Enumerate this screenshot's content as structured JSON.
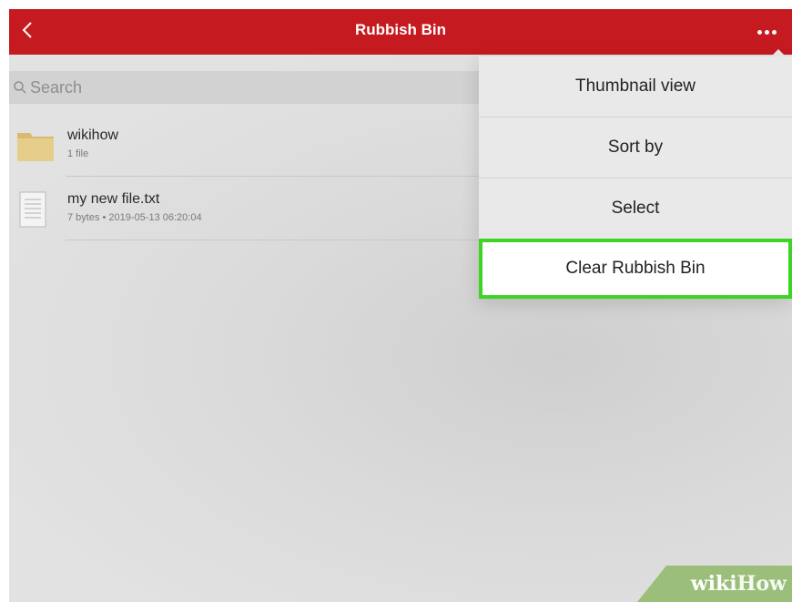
{
  "header": {
    "title": "Rubbish Bin",
    "back_icon": "chevron-left-icon",
    "more_icon": "more-dots-icon"
  },
  "search": {
    "placeholder": "Search",
    "icon": "search-icon"
  },
  "files": [
    {
      "name": "wikihow",
      "meta": "1 file",
      "icon": "folder-icon"
    },
    {
      "name": "my new file.txt",
      "meta": "7 bytes • 2019-05-13 06:20:04",
      "icon": "text-file-icon"
    }
  ],
  "menu": {
    "items": [
      {
        "label": "Thumbnail view"
      },
      {
        "label": "Sort by"
      },
      {
        "label": "Select"
      },
      {
        "label": "Clear Rubbish Bin"
      }
    ]
  },
  "watermark": {
    "part1": "wiki",
    "part2": "How"
  },
  "colors": {
    "header_bg": "#c51a1f",
    "highlight_border": "#3ed425",
    "watermark_bg": "#9bbf7a"
  }
}
